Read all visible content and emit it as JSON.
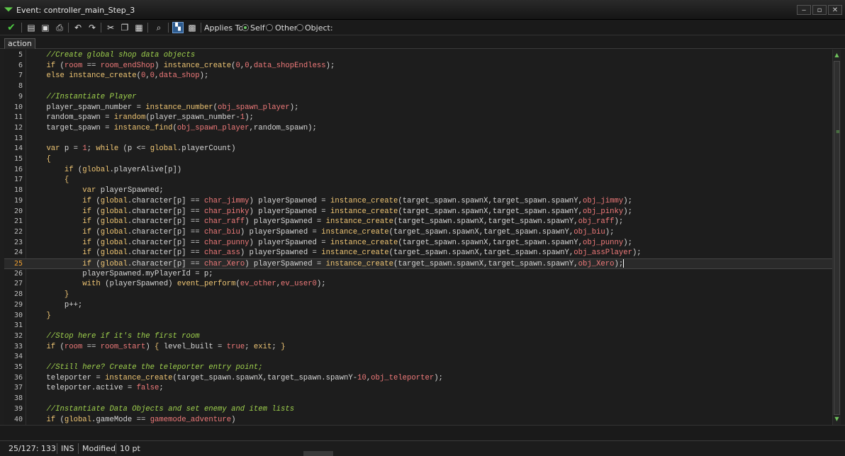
{
  "window": {
    "title": "Event: controller_main_Step_3",
    "minimize": "‒",
    "maximize": "▫",
    "close": "✕"
  },
  "toolbar": {
    "applies_to_label": "Applies To:",
    "options": [
      {
        "label": "Self",
        "selected": true
      },
      {
        "label": "Other",
        "selected": false
      },
      {
        "label": "Object:",
        "selected": false
      }
    ]
  },
  "tabs": [
    {
      "label": "action"
    }
  ],
  "editor": {
    "current_line": 25,
    "lines": [
      {
        "n": "5",
        "html": "    <span class='cm'>//Create global shop data objects</span>"
      },
      {
        "n": "6",
        "html": "    <span class='kw'>if</span> (<span class='rs'>room</span> == <span class='rs'>room_endShop</span>) <span class='fn'>instance_create</span>(<span class='nm'>0</span>,<span class='nm'>0</span>,<span class='rs'>data_shopEndless</span>);"
      },
      {
        "n": "7",
        "html": "    <span class='kw'>else</span> <span class='fn'>instance_create</span>(<span class='nm'>0</span>,<span class='nm'>0</span>,<span class='rs'>data_shop</span>);"
      },
      {
        "n": "8",
        "html": ""
      },
      {
        "n": "9",
        "html": "    <span class='cm'>//Instantiate Player</span>"
      },
      {
        "n": "10",
        "html": "    player_spawn_number = <span class='fn'>instance_number</span>(<span class='rs'>obj_spawn_player</span>);"
      },
      {
        "n": "11",
        "html": "    random_spawn = <span class='fn'>irandom</span>(player_spawn_number-<span class='nm'>1</span>);"
      },
      {
        "n": "12",
        "html": "    target_spawn = <span class='fn'>instance_find</span>(<span class='rs'>obj_spawn_player</span>,random_spawn);"
      },
      {
        "n": "13",
        "html": ""
      },
      {
        "n": "14",
        "html": "    <span class='kw'>var</span> p = <span class='nm'>1</span>; <span class='kw'>while</span> (p &lt;= <span class='gl'>global</span>.playerCount)"
      },
      {
        "n": "15",
        "html": "    <span class='kw'>{</span>"
      },
      {
        "n": "16",
        "html": "        <span class='kw'>if</span> (<span class='gl'>global</span>.playerAlive[p])"
      },
      {
        "n": "17",
        "html": "        <span class='kw'>{</span>"
      },
      {
        "n": "18",
        "html": "            <span class='kw'>var</span> playerSpawned;"
      },
      {
        "n": "19",
        "html": "            <span class='kw'>if</span> (<span class='gl'>global</span>.character[p] == <span class='rs'>char_jimmy</span>) playerSpawned = <span class='fn'>instance_create</span>(target_spawn.spawnX,target_spawn.spawnY,<span class='rs'>obj_jimmy</span>);"
      },
      {
        "n": "20",
        "html": "            <span class='kw'>if</span> (<span class='gl'>global</span>.character[p] == <span class='rs'>char_pinky</span>) playerSpawned = <span class='fn'>instance_create</span>(target_spawn.spawnX,target_spawn.spawnY,<span class='rs'>obj_pinky</span>);"
      },
      {
        "n": "21",
        "html": "            <span class='kw'>if</span> (<span class='gl'>global</span>.character[p] == <span class='rs'>char_raff</span>) playerSpawned = <span class='fn'>instance_create</span>(target_spawn.spawnX,target_spawn.spawnY,<span class='rs'>obj_raff</span>);"
      },
      {
        "n": "22",
        "html": "            <span class='kw'>if</span> (<span class='gl'>global</span>.character[p] == <span class='rs'>char_biu</span>) playerSpawned = <span class='fn'>instance_create</span>(target_spawn.spawnX,target_spawn.spawnY,<span class='rs'>obj_biu</span>);"
      },
      {
        "n": "23",
        "html": "            <span class='kw'>if</span> (<span class='gl'>global</span>.character[p] == <span class='rs'>char_punny</span>) playerSpawned = <span class='fn'>instance_create</span>(target_spawn.spawnX,target_spawn.spawnY,<span class='rs'>obj_punny</span>);"
      },
      {
        "n": "24",
        "html": "            <span class='kw'>if</span> (<span class='gl'>global</span>.character[p] == <span class='rs'>char_ass</span>) playerSpawned = <span class='fn'>instance_create</span>(target_spawn.spawnX,target_spawn.spawnY,<span class='rs'>obj_assPlayer</span>);"
      },
      {
        "n": "25",
        "html": "            <span class='kw'>if</span> (<span class='gl'>global</span>.character[p] == <span class='rs'>char_Xero</span>) playerSpawned = <span class='fn'>instance_create</span>(target_spawn.spawnX,target_spawn.spawnY,<span class='rs'>obj_Xero</span>);<span class='caret'></span>"
      },
      {
        "n": "26",
        "html": "            playerSpawned.myPlayerId = p;"
      },
      {
        "n": "27",
        "html": "            <span class='kw'>with</span> (playerSpawned) <span class='fn'>event_perform</span>(<span class='rs'>ev_other</span>,<span class='rs'>ev_user0</span>);"
      },
      {
        "n": "28",
        "html": "        <span class='kw'>}</span>"
      },
      {
        "n": "29",
        "html": "        p++;"
      },
      {
        "n": "30",
        "html": "    <span class='kw'>}</span>"
      },
      {
        "n": "31",
        "html": ""
      },
      {
        "n": "32",
        "html": "    <span class='cm'>//Stop here if it's the first room</span>"
      },
      {
        "n": "33",
        "html": "    <span class='kw'>if</span> (<span class='rs'>room</span> == <span class='rs'>room_start</span>) <span class='kw'>{</span> level_built = <span class='rs'>true</span>; <span class='kw'>exit</span>; <span class='kw'>}</span>"
      },
      {
        "n": "34",
        "html": ""
      },
      {
        "n": "35",
        "html": "    <span class='cm'>//Still here? Create the teleporter entry point;</span>"
      },
      {
        "n": "36",
        "html": "    teleporter = <span class='fn'>instance_create</span>(target_spawn.spawnX,target_spawn.spawnY-<span class='nm'>10</span>,<span class='rs'>obj_teleporter</span>);"
      },
      {
        "n": "37",
        "html": "    teleporter.active = <span class='rs'>false</span>;"
      },
      {
        "n": "38",
        "html": ""
      },
      {
        "n": "39",
        "html": "    <span class='cm'>//Instantiate Data Objects and set enemy and item lists</span>"
      },
      {
        "n": "40",
        "html": "    <span class='kw'>if</span> (<span class='gl'>global</span>.gameMode == <span class='rs'>gamemode_adventure</span>)"
      }
    ]
  },
  "status": {
    "position": "25/127: 133",
    "mode": "INS",
    "modified": "Modified",
    "font_size": "10 pt"
  },
  "colors": {
    "comment": "#9fd14d",
    "keyword": "#f0c674",
    "resource": "#f07a7a",
    "accent": "#4ec943"
  }
}
